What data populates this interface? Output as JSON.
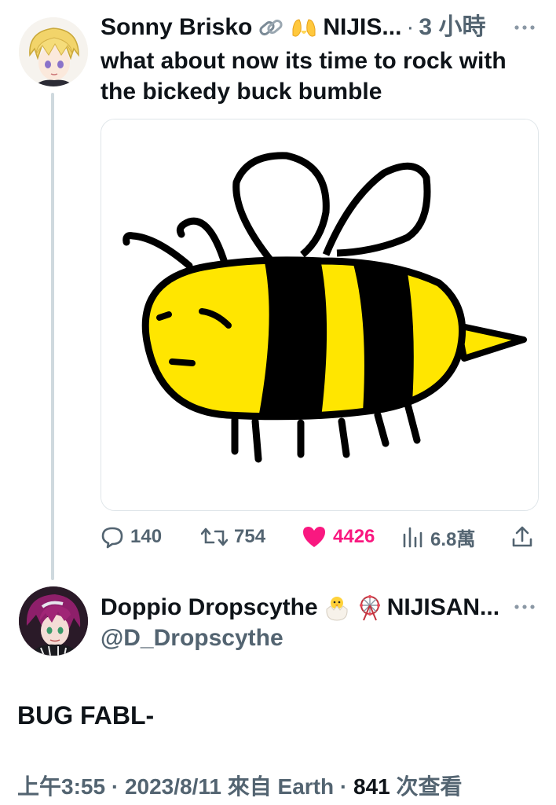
{
  "tweets": [
    {
      "author": "Sonny Brisko",
      "name_suffix": "NIJIS...",
      "separator": "·",
      "time": "3 小時",
      "text": "what about now its time to rock with the bickedy buck bumble",
      "icons": [
        "link-emoji",
        "raising-hands-emoji",
        "more-icon"
      ],
      "media": {
        "icon": "bee-drawing"
      },
      "actions": {
        "replies": "140",
        "retweets": "754",
        "likes": "4426",
        "views": "6.8萬"
      }
    },
    {
      "author": "Doppio Dropscythe",
      "name_suffix": "NIJISAN...",
      "handle": "@D_Dropscythe",
      "text": "BUG FABL-",
      "icons": [
        "hatching-chick-emoji",
        "ferris-wheel-emoji",
        "more-icon"
      ],
      "meta": {
        "time": "上午3:55",
        "sep1": "·",
        "date": "2023/8/11",
        "source": "來自 Earth",
        "sep2": "·",
        "views_count": "841",
        "views_label": "次查看"
      }
    }
  ],
  "colors": {
    "text": "#0f1419",
    "muted": "#536471",
    "like": "#f91880",
    "bee_yellow": "#ffe600",
    "thread_line": "#cfd9de"
  }
}
